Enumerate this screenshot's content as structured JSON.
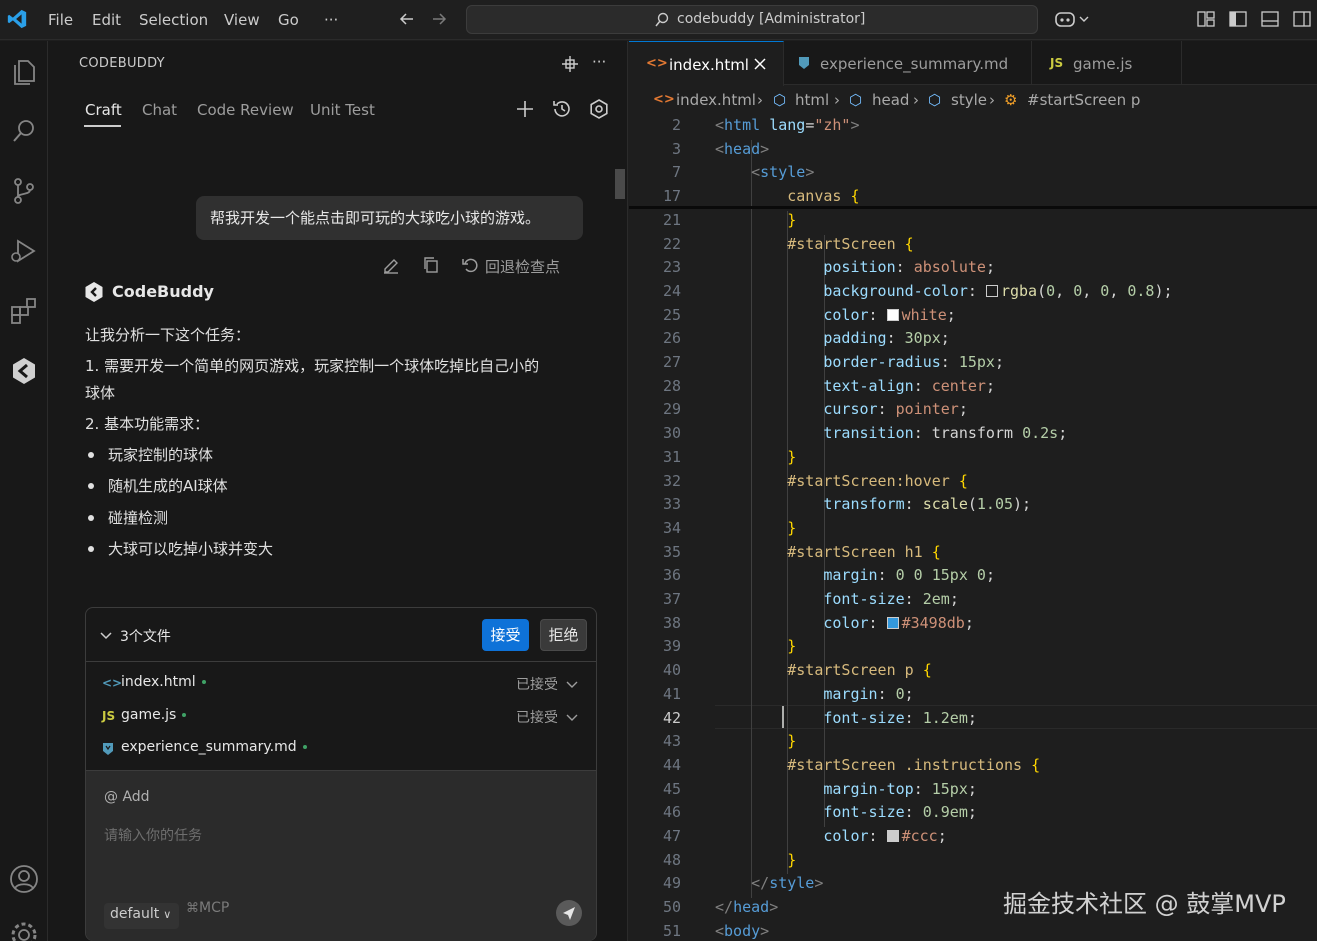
{
  "menu": [
    "File",
    "Edit",
    "Selection",
    "View",
    "Go",
    "···"
  ],
  "command_center": "codebuddy [Administrator]",
  "panel": {
    "title": "CODEBUDDY",
    "tabs": [
      "Craft",
      "Chat",
      "Code Review",
      "Unit Test"
    ]
  },
  "chat": {
    "user_message": "帮我开发一个能点击即可玩的大球吃小球的游戏。",
    "revert_label": "回退检查点",
    "bot_name": "CodeBuddy",
    "response": {
      "intro": "让我分析一下这个任务：",
      "item1_line1": "1. 需要开发一个简单的网页游戏，玩家控制一个球体吃掉比自己小的",
      "item1_line2": "球体",
      "item2": "2. 基本功能需求：",
      "bullets": [
        "玩家控制的球体",
        "随机生成的AI球体",
        "碰撞检测",
        "大球可以吃掉小球并变大"
      ]
    }
  },
  "files_card": {
    "summary": "3个文件",
    "accept_label": "接受",
    "reject_label": "拒绝",
    "files": [
      {
        "icon": "<>",
        "name": "index.html",
        "status": "已接受"
      },
      {
        "icon": "JS",
        "name": "game.js",
        "status": "已接受"
      },
      {
        "icon": "",
        "name": "experience_summary.md",
        "status": ""
      }
    ]
  },
  "input": {
    "add_label": "@ Add",
    "placeholder": "请输入你的任务",
    "mode": "default",
    "mcp_label": "MCP"
  },
  "editor": {
    "tabs": [
      {
        "icon": "<>",
        "label": "index.html",
        "active": true
      },
      {
        "icon": "",
        "label": "experience_summary.md",
        "active": false
      },
      {
        "icon": "JS",
        "label": "game.js",
        "active": false
      }
    ],
    "breadcrumb": [
      "index.html",
      "html",
      "head",
      "style",
      "#startScreen p"
    ],
    "current_line": "42",
    "lines": [
      {
        "n": "2",
        "t": [
          [
            "t-bracket",
            "<"
          ],
          [
            "t-tag",
            "html"
          ],
          [
            "t-plain",
            " "
          ],
          [
            "t-attr",
            "lang"
          ],
          [
            "t-plain",
            "="
          ],
          [
            "t-str",
            "\"zh\""
          ],
          [
            "t-bracket",
            ">"
          ]
        ]
      },
      {
        "n": "3",
        "t": [
          [
            "t-bracket",
            "<"
          ],
          [
            "t-tag",
            "head"
          ],
          [
            "t-bracket",
            ">"
          ]
        ]
      },
      {
        "n": "7",
        "t": [
          [
            "t-plain",
            "    "
          ],
          [
            "t-bracket",
            "<"
          ],
          [
            "t-tag",
            "style"
          ],
          [
            "t-bracket",
            ">"
          ]
        ]
      },
      {
        "n": "17",
        "t": [
          [
            "t-plain",
            "        "
          ],
          [
            "t-sel",
            "canvas"
          ],
          [
            "t-plain",
            " "
          ],
          [
            "t-brace",
            "{"
          ]
        ]
      },
      {
        "n": "21",
        "t": [
          [
            "t-plain",
            "        "
          ],
          [
            "t-brace",
            "}"
          ]
        ]
      },
      {
        "n": "22",
        "t": [
          [
            "t-plain",
            "        "
          ],
          [
            "t-sel",
            "#startScreen"
          ],
          [
            "t-plain",
            " "
          ],
          [
            "t-brace",
            "{"
          ]
        ]
      },
      {
        "n": "23",
        "t": [
          [
            "t-plain",
            "            "
          ],
          [
            "t-prop",
            "position"
          ],
          [
            "t-plain",
            ": "
          ],
          [
            "t-val",
            "absolute"
          ],
          [
            "t-plain",
            ";"
          ]
        ]
      },
      {
        "n": "24",
        "t": [
          [
            "t-plain",
            "            "
          ],
          [
            "t-prop",
            "background-color"
          ],
          [
            "t-plain",
            ": "
          ],
          [
            "swatch",
            "transparent"
          ],
          [
            "t-fn",
            "rgba"
          ],
          [
            "t-plain",
            "("
          ],
          [
            "t-num",
            "0"
          ],
          [
            "t-plain",
            ", "
          ],
          [
            "t-num",
            "0"
          ],
          [
            "t-plain",
            ", "
          ],
          [
            "t-num",
            "0"
          ],
          [
            "t-plain",
            ", "
          ],
          [
            "t-num",
            "0.8"
          ],
          [
            "t-plain",
            ");"
          ]
        ]
      },
      {
        "n": "25",
        "t": [
          [
            "t-plain",
            "            "
          ],
          [
            "t-prop",
            "color"
          ],
          [
            "t-plain",
            ": "
          ],
          [
            "swatch",
            "#ffffff"
          ],
          [
            "t-val",
            "white"
          ],
          [
            "t-plain",
            ";"
          ]
        ]
      },
      {
        "n": "26",
        "t": [
          [
            "t-plain",
            "            "
          ],
          [
            "t-prop",
            "padding"
          ],
          [
            "t-plain",
            ": "
          ],
          [
            "t-num",
            "30px"
          ],
          [
            "t-plain",
            ";"
          ]
        ]
      },
      {
        "n": "27",
        "t": [
          [
            "t-plain",
            "            "
          ],
          [
            "t-prop",
            "border-radius"
          ],
          [
            "t-plain",
            ": "
          ],
          [
            "t-num",
            "15px"
          ],
          [
            "t-plain",
            ";"
          ]
        ]
      },
      {
        "n": "28",
        "t": [
          [
            "t-plain",
            "            "
          ],
          [
            "t-prop",
            "text-align"
          ],
          [
            "t-plain",
            ": "
          ],
          [
            "t-val",
            "center"
          ],
          [
            "t-plain",
            ";"
          ]
        ]
      },
      {
        "n": "29",
        "t": [
          [
            "t-plain",
            "            "
          ],
          [
            "t-prop",
            "cursor"
          ],
          [
            "t-plain",
            ": "
          ],
          [
            "t-val",
            "pointer"
          ],
          [
            "t-plain",
            ";"
          ]
        ]
      },
      {
        "n": "30",
        "t": [
          [
            "t-plain",
            "            "
          ],
          [
            "t-prop",
            "transition"
          ],
          [
            "t-plain",
            ": "
          ],
          [
            "t-plain",
            "transform "
          ],
          [
            "t-num",
            "0.2s"
          ],
          [
            "t-plain",
            ";"
          ]
        ]
      },
      {
        "n": "31",
        "t": [
          [
            "t-plain",
            "        "
          ],
          [
            "t-brace",
            "}"
          ]
        ]
      },
      {
        "n": "32",
        "t": [
          [
            "t-plain",
            "        "
          ],
          [
            "t-sel",
            "#startScreen:hover"
          ],
          [
            "t-plain",
            " "
          ],
          [
            "t-brace",
            "{"
          ]
        ]
      },
      {
        "n": "33",
        "t": [
          [
            "t-plain",
            "            "
          ],
          [
            "t-prop",
            "transform"
          ],
          [
            "t-plain",
            ": "
          ],
          [
            "t-fn",
            "scale"
          ],
          [
            "t-plain",
            "("
          ],
          [
            "t-num",
            "1.05"
          ],
          [
            "t-plain",
            ");"
          ]
        ]
      },
      {
        "n": "34",
        "t": [
          [
            "t-plain",
            "        "
          ],
          [
            "t-brace",
            "}"
          ]
        ]
      },
      {
        "n": "35",
        "t": [
          [
            "t-plain",
            "        "
          ],
          [
            "t-sel",
            "#startScreen h1"
          ],
          [
            "t-plain",
            " "
          ],
          [
            "t-brace",
            "{"
          ]
        ]
      },
      {
        "n": "36",
        "t": [
          [
            "t-plain",
            "            "
          ],
          [
            "t-prop",
            "margin"
          ],
          [
            "t-plain",
            ": "
          ],
          [
            "t-num",
            "0 0 15px 0"
          ],
          [
            "t-plain",
            ";"
          ]
        ]
      },
      {
        "n": "37",
        "t": [
          [
            "t-plain",
            "            "
          ],
          [
            "t-prop",
            "font-size"
          ],
          [
            "t-plain",
            ": "
          ],
          [
            "t-num",
            "2em"
          ],
          [
            "t-plain",
            ";"
          ]
        ]
      },
      {
        "n": "38",
        "t": [
          [
            "t-plain",
            "            "
          ],
          [
            "t-prop",
            "color"
          ],
          [
            "t-plain",
            ": "
          ],
          [
            "swatch",
            "#3498db"
          ],
          [
            "t-val",
            "#3498db"
          ],
          [
            "t-plain",
            ";"
          ]
        ]
      },
      {
        "n": "39",
        "t": [
          [
            "t-plain",
            "        "
          ],
          [
            "t-brace",
            "}"
          ]
        ]
      },
      {
        "n": "40",
        "t": [
          [
            "t-plain",
            "        "
          ],
          [
            "t-sel",
            "#startScreen p"
          ],
          [
            "t-plain",
            " "
          ],
          [
            "t-brace",
            "{"
          ]
        ]
      },
      {
        "n": "41",
        "t": [
          [
            "t-plain",
            "            "
          ],
          [
            "t-prop",
            "margin"
          ],
          [
            "t-plain",
            ": "
          ],
          [
            "t-num",
            "0"
          ],
          [
            "t-plain",
            ";"
          ]
        ]
      },
      {
        "n": "42",
        "t": [
          [
            "t-plain",
            "            "
          ],
          [
            "t-prop",
            "font-size"
          ],
          [
            "t-plain",
            ": "
          ],
          [
            "t-num",
            "1.2em"
          ],
          [
            "t-plain",
            ";"
          ]
        ]
      },
      {
        "n": "43",
        "t": [
          [
            "t-plain",
            "        "
          ],
          [
            "t-brace",
            "}"
          ]
        ]
      },
      {
        "n": "44",
        "t": [
          [
            "t-plain",
            "        "
          ],
          [
            "t-sel",
            "#startScreen .instructions"
          ],
          [
            "t-plain",
            " "
          ],
          [
            "t-brace",
            "{"
          ]
        ]
      },
      {
        "n": "45",
        "t": [
          [
            "t-plain",
            "            "
          ],
          [
            "t-prop",
            "margin-top"
          ],
          [
            "t-plain",
            ": "
          ],
          [
            "t-num",
            "15px"
          ],
          [
            "t-plain",
            ";"
          ]
        ]
      },
      {
        "n": "46",
        "t": [
          [
            "t-plain",
            "            "
          ],
          [
            "t-prop",
            "font-size"
          ],
          [
            "t-plain",
            ": "
          ],
          [
            "t-num",
            "0.9em"
          ],
          [
            "t-plain",
            ";"
          ]
        ]
      },
      {
        "n": "47",
        "t": [
          [
            "t-plain",
            "            "
          ],
          [
            "t-prop",
            "color"
          ],
          [
            "t-plain",
            ": "
          ],
          [
            "swatch",
            "#cccccc"
          ],
          [
            "t-val",
            "#ccc"
          ],
          [
            "t-plain",
            ";"
          ]
        ]
      },
      {
        "n": "48",
        "t": [
          [
            "t-plain",
            "        "
          ],
          [
            "t-brace",
            "}"
          ]
        ]
      },
      {
        "n": "49",
        "t": [
          [
            "t-plain",
            "    "
          ],
          [
            "t-bracket",
            "</"
          ],
          [
            "t-tag",
            "style"
          ],
          [
            "t-bracket",
            ">"
          ]
        ]
      },
      {
        "n": "50",
        "t": [
          [
            "t-bracket",
            "</"
          ],
          [
            "t-tag",
            "head"
          ],
          [
            "t-bracket",
            ">"
          ]
        ]
      },
      {
        "n": "51",
        "t": [
          [
            "t-bracket",
            "<"
          ],
          [
            "t-tag",
            "body"
          ],
          [
            "t-bracket",
            ">"
          ]
        ]
      }
    ]
  },
  "watermark": "掘金技术社区 @ 鼓掌MVP",
  "colors": {
    "accent": "#0078d4",
    "accept_button": "#0e72d8",
    "modified_dot": "#3fa266"
  }
}
